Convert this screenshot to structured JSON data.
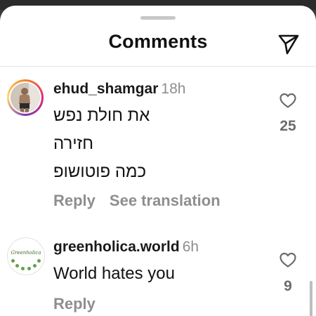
{
  "sheet": {
    "title": "Comments"
  },
  "comments": [
    {
      "username": "ehud_shamgar",
      "time": "18h",
      "lines": [
        "את חולת נפש",
        "חזירה",
        "כמה פוטושופ"
      ],
      "reply_label": "Reply",
      "translate_label": "See translation",
      "likes": "25"
    },
    {
      "username": "greenholica.world",
      "time": "6h",
      "avatar_text": "Greenholica",
      "lines": [
        "World hates you"
      ],
      "reply_label": "Reply",
      "likes": "9"
    }
  ],
  "icons": {
    "share": "paper-plane-icon",
    "like": "heart-outline-icon"
  },
  "colors": {
    "text": "#111111",
    "secondary": "#8e8e8e",
    "story_ring": "#dd2a7b"
  }
}
